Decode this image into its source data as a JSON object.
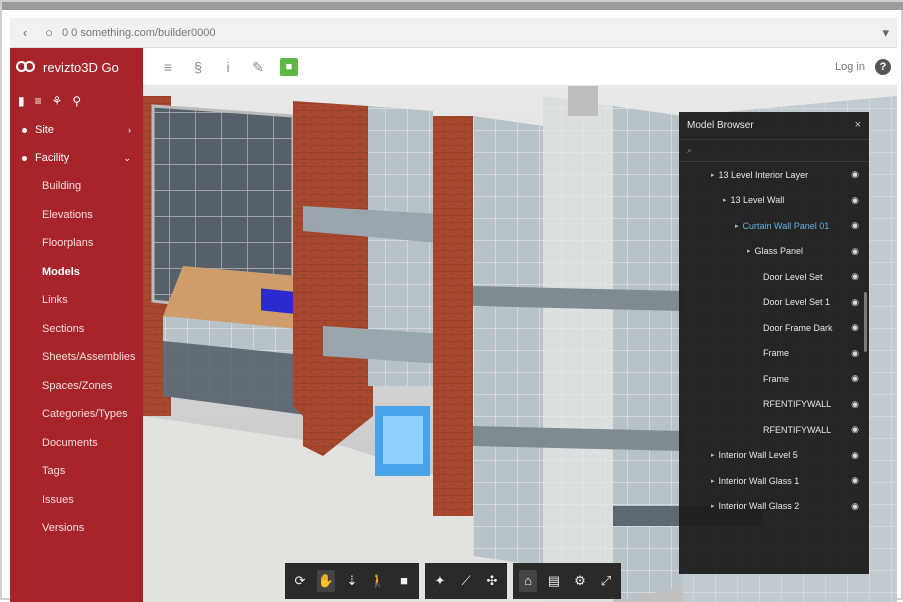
{
  "browser": {
    "back_icon": "back-arrow-icon",
    "url": "0 0 something.com/builder0000",
    "extension_icon": "extension-icon"
  },
  "app": {
    "brand": "revizto3D Go",
    "toolbar": [
      {
        "name": "menu-icon",
        "glyph": "≡"
      },
      {
        "name": "link-icon",
        "glyph": "§"
      },
      {
        "name": "info-icon",
        "glyph": "i"
      },
      {
        "name": "eraser-icon",
        "glyph": "✎"
      },
      {
        "name": "green-tool-icon",
        "glyph": "■"
      }
    ],
    "login": "Log in",
    "help": "?"
  },
  "sidebar": {
    "icons": [
      "file-icon",
      "layers-icon",
      "tree-icon",
      "filter-icon"
    ],
    "categories": [
      {
        "label": "Site",
        "collapsed": true
      },
      {
        "label": "Facility",
        "collapsed": false
      }
    ],
    "items": [
      "Building",
      "Elevations",
      "Floorplans",
      "Models",
      "Links",
      "Sections",
      "Sheets/Assemblies",
      "Spaces/Zones",
      "Categories/Types",
      "Documents",
      "Tags",
      "Issues",
      "Versions"
    ],
    "active_item": "Models"
  },
  "model_browser": {
    "title": "Model Browser",
    "close": "×",
    "search_placeholder": "",
    "rows": [
      {
        "label": "13 Level Interior Layer",
        "indent": 1,
        "selected": false
      },
      {
        "label": "13 Level Wall",
        "indent": 2,
        "selected": false
      },
      {
        "label": "Curtain Wall Panel 01",
        "indent": 3,
        "selected": true
      },
      {
        "label": "Glass Panel",
        "indent": 4,
        "selected": false
      },
      {
        "label": "Door Level Set",
        "indent": 5,
        "selected": false
      },
      {
        "label": "Door Level Set 1",
        "indent": 5,
        "selected": false
      },
      {
        "label": "Door Frame Dark",
        "indent": 5,
        "selected": false
      },
      {
        "label": "Frame",
        "indent": 5,
        "selected": false
      },
      {
        "label": "Frame",
        "indent": 5,
        "selected": false
      },
      {
        "label": "RFENTIFYWALL",
        "indent": 5,
        "selected": false
      },
      {
        "label": "RFENTIFYWALL",
        "indent": 5,
        "selected": false
      },
      {
        "label": "Interior Wall Level 5",
        "indent": 1,
        "selected": false
      },
      {
        "label": "Interior Wall Glass 1",
        "indent": 1,
        "selected": false
      },
      {
        "label": "Interior Wall Glass 2",
        "indent": 1,
        "selected": false
      }
    ],
    "eye_glyph": "👁"
  },
  "bottom_toolbar": {
    "groups": [
      [
        {
          "name": "orbit-icon",
          "glyph": "⟳",
          "active": false
        },
        {
          "name": "pan-hand-icon",
          "glyph": "✋",
          "active": true
        },
        {
          "name": "walk-icon",
          "glyph": "⇣",
          "active": false
        },
        {
          "name": "person-icon",
          "glyph": "🚶",
          "active": false
        },
        {
          "name": "camera-icon",
          "glyph": "■",
          "active": false
        }
      ],
      [
        {
          "name": "section-icon",
          "glyph": "✦",
          "active": false
        },
        {
          "name": "measure-icon",
          "glyph": "⟋",
          "active": false
        },
        {
          "name": "explode-icon",
          "glyph": "✣",
          "active": false
        }
      ],
      [
        {
          "name": "model-tree-icon",
          "glyph": "⌂",
          "active": true
        },
        {
          "name": "properties-icon",
          "glyph": "▤",
          "active": false
        },
        {
          "name": "settings-icon",
          "glyph": "⚙",
          "active": false
        },
        {
          "name": "fullscreen-icon",
          "glyph": "⤢",
          "active": false
        }
      ]
    ]
  },
  "colors": {
    "brand": "#a8242b",
    "panel": "#1d1d1d",
    "selected": "#5fb0e0",
    "green": "#5fb545"
  }
}
